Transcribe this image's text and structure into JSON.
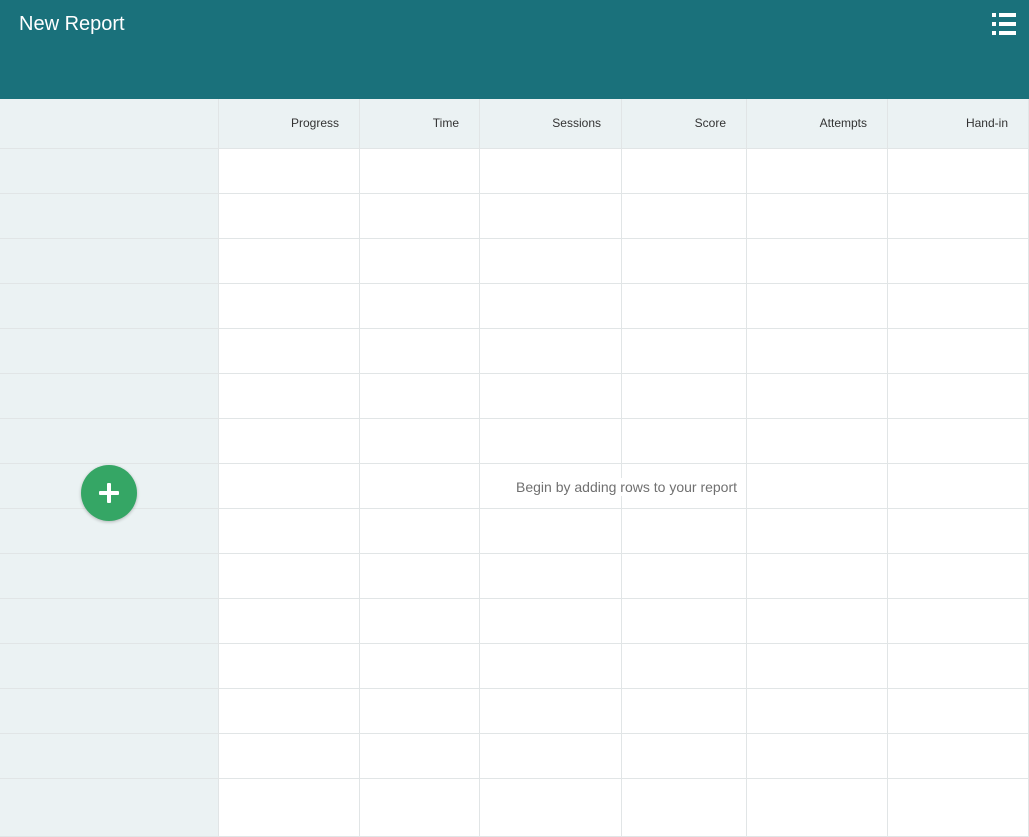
{
  "header": {
    "title": "New Report",
    "menu_icon": "list-icon",
    "background_color": "#1a717b"
  },
  "table": {
    "columns": [
      "Progress",
      "Time",
      "Sessions",
      "Score",
      "Attempts",
      "Hand-in"
    ],
    "row_count": 15,
    "empty_message": "Begin by adding rows to your report"
  },
  "add_row_button": {
    "icon": "plus-icon",
    "color": "#35a665"
  }
}
